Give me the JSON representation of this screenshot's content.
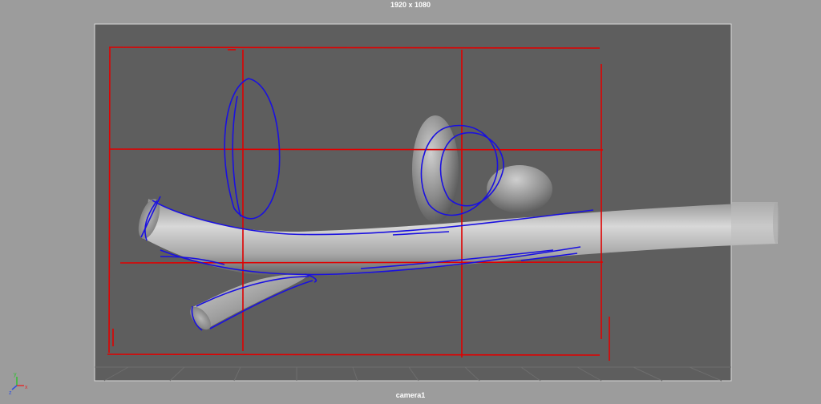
{
  "viewport": {
    "resolution_gate_label": "1920 x 1080",
    "camera_name": "camera1"
  },
  "axis_gizmo": {
    "y_label": "y",
    "x_label": "x",
    "z_label": "z"
  },
  "colors": {
    "background": "#9c9c9c",
    "film_gate_fill": "#5e5e5e",
    "film_gate_border": "#d8d8d8",
    "sketch_grid": "#e00000",
    "sketch_curves": "#1a10e0",
    "mesh_light": "#d6d6d6",
    "mesh_dark": "#5a5a5a",
    "axis_x": "#e03030",
    "axis_y": "#30c030",
    "axis_z": "#3050e0"
  }
}
